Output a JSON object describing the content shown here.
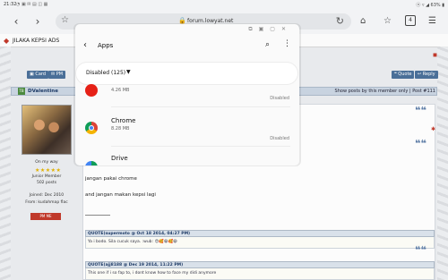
{
  "status_bar": {
    "time": "21:32",
    "icons": "◔ ▣ ✉ ▤ ◫ ▦",
    "right": "ⓝ ▿ ◢ 63% ▮"
  },
  "browser": {
    "url": "forum.lowyat.net",
    "tab_count": "4"
  },
  "site": {
    "title": "JILAKA KEPSI ADS",
    "top_marker": "◼"
  },
  "post1": {
    "card_label": "Card",
    "pm_label": "PM",
    "quote_label": "Quote",
    "reply_label": "Reply",
    "user_badge": "TB",
    "username": "DValentine",
    "show_posts": "Show posts by this member only | Post #111",
    "status": "On my way",
    "rank": "Junior Member",
    "posts": "502 posts",
    "joined": "Joined: Dec 2010",
    "from": "From: kudahmap flac",
    "pm_badge": "PM ME",
    "lines": [
      "jangan pakai chrome",
      "and jangan makan kepsi lagi"
    ],
    "quote1_header": "QUOTE(supermoto @ Oct 18 2014, 04:27 PM)",
    "quote1_body": "Ya i bodo. Sila cucuk saya. :wub: 😍🥰😁🥰😁",
    "quote2_header": "QUOTE(ajj8188 @ Dec 19 2014, 11:22 PM)",
    "quote2_body": "This one if i so fap to, i dont know how to face my didi anymore"
  },
  "popup": {
    "title": "Apps",
    "filter": "Disabled (125)",
    "apps": [
      {
        "name": "",
        "size": "4.26 MB",
        "status": "Disabled",
        "icon_color": "#e62117"
      },
      {
        "name": "Chrome",
        "size": "8.28 MB",
        "status": "Disabled",
        "icon_color": "#4285f4"
      },
      {
        "name": "Drive",
        "size": "",
        "status": "",
        "icon_color": "#0f9d58"
      }
    ]
  }
}
